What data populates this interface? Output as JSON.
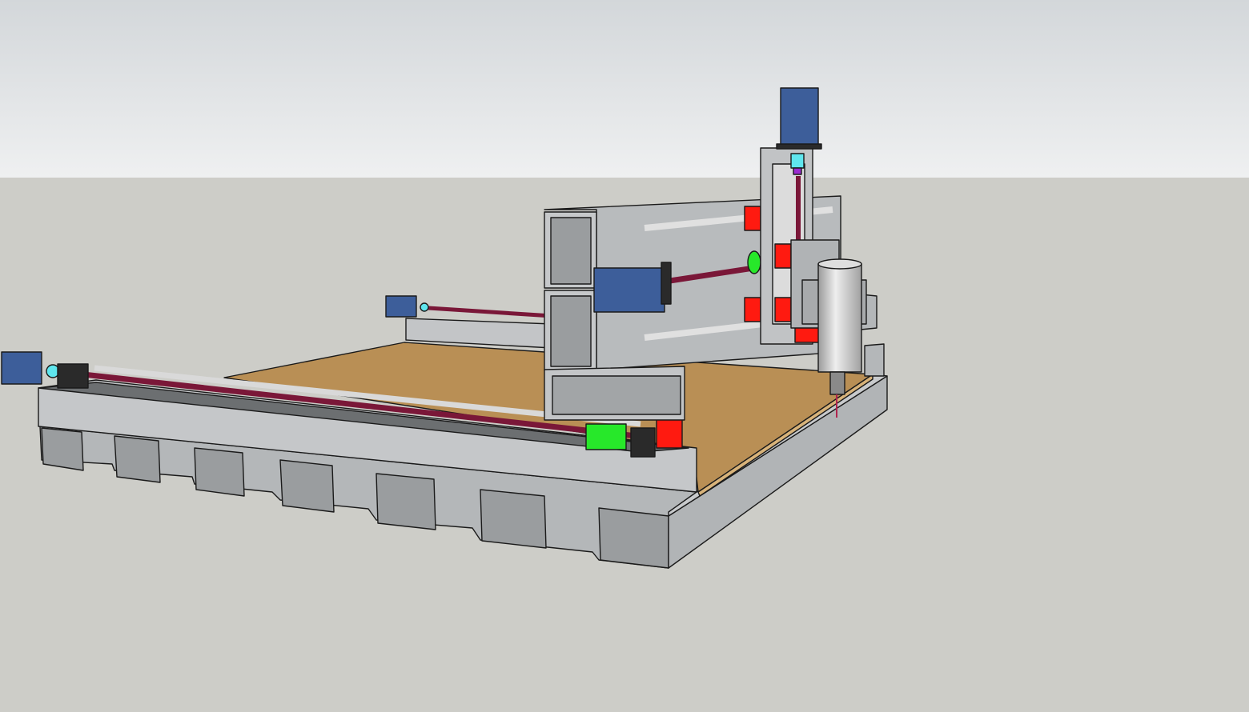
{
  "scene": {
    "sky_top": "#d3d7da",
    "sky_bottom": "#eff0f1",
    "ground": "#cdcdc8",
    "steel_light": "#c9cbcd",
    "steel_mid": "#a9acae",
    "steel_dark": "#7d8082",
    "wood": "#b98f55",
    "motor": "#3d5e9a",
    "rod": "#7a1738",
    "bearing_block": "#ff1a10",
    "coupler": "#27e82a",
    "shaft_coupling": "#5fe6ee",
    "spindle": "#c4c4c4"
  }
}
